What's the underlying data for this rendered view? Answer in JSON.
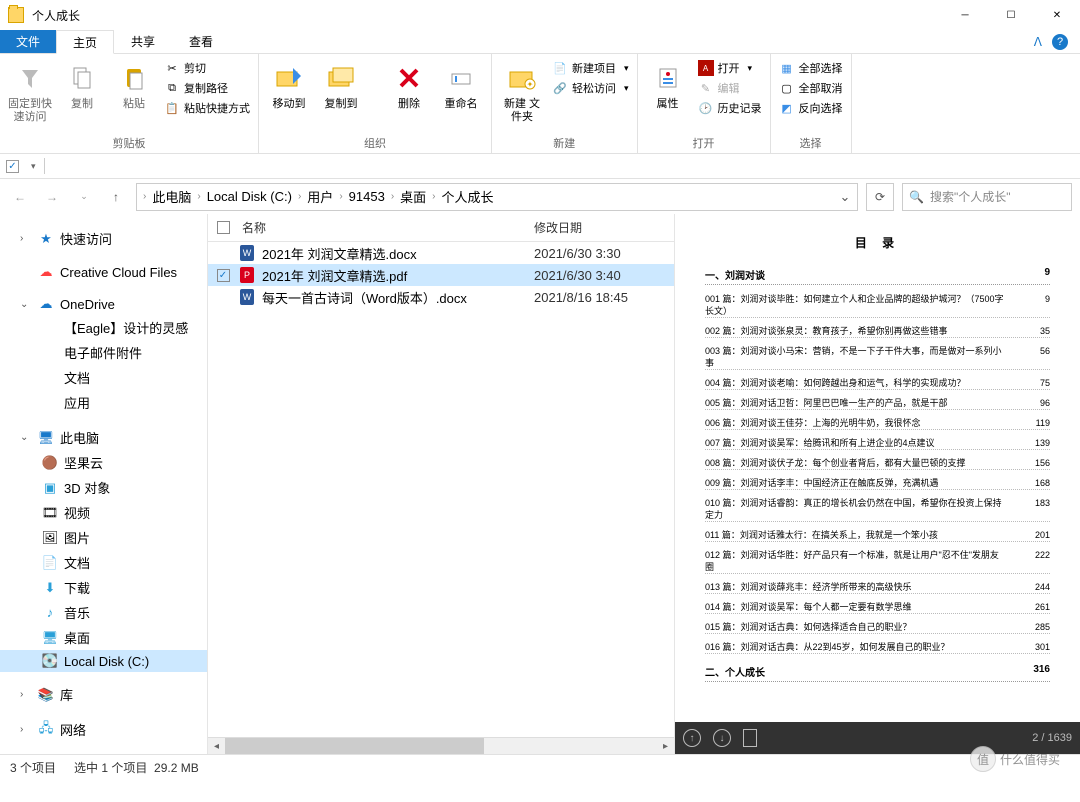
{
  "window": {
    "title": "个人成长"
  },
  "tabs": {
    "file": "文件",
    "home": "主页",
    "share": "共享",
    "view": "查看"
  },
  "ribbon": {
    "g1": {
      "pin": "固定到快\n速访问",
      "copy": "复制",
      "paste": "粘贴",
      "cut": "剪切",
      "copypath": "复制路径",
      "pasteshortcut": "粘贴快捷方式",
      "label": "剪贴板"
    },
    "g2": {
      "moveto": "移动到",
      "copyto": "复制到",
      "delete": "删除",
      "rename": "重命名",
      "label": "组织"
    },
    "g3": {
      "newfolder": "新建\n文件夹",
      "newitem": "新建项目",
      "easyaccess": "轻松访问",
      "label": "新建"
    },
    "g4": {
      "props": "属性",
      "open": "打开",
      "edit": "编辑",
      "history": "历史记录",
      "label": "打开"
    },
    "g5": {
      "selectall": "全部选择",
      "selectnone": "全部取消",
      "invert": "反向选择",
      "label": "选择"
    }
  },
  "breadcrumb": [
    "此电脑",
    "Local Disk (C:)",
    "用户",
    "91453",
    "桌面",
    "个人成长"
  ],
  "search": {
    "placeholder": "搜索\"个人成长\""
  },
  "columns": {
    "name": "名称",
    "date": "修改日期"
  },
  "files": [
    {
      "name": "2021年 刘润文章精选.docx",
      "date": "2021/6/30 3:30",
      "type": "docx",
      "sel": false
    },
    {
      "name": "2021年 刘润文章精选.pdf",
      "date": "2021/6/30 3:40",
      "type": "pdf",
      "sel": true
    },
    {
      "name": "每天一首古诗词（Word版本）.docx",
      "date": "2021/8/16 18:45",
      "type": "docx",
      "sel": false
    }
  ],
  "nav": {
    "quick": "快速访问",
    "ccf": "Creative Cloud Files",
    "onedrive": "OneDrive",
    "od": {
      "eagle": "【Eagle】设计的灵感",
      "email": "电子邮件附件",
      "docs": "文档",
      "apps": "应用"
    },
    "thispc": "此电脑",
    "pc": {
      "jgy": "坚果云",
      "obj3d": "3D 对象",
      "video": "视频",
      "pic": "图片",
      "doc": "文档",
      "dl": "下载",
      "music": "音乐",
      "desktop": "桌面",
      "cdisk": "Local Disk (C:)"
    },
    "lib": "库",
    "net": "网络"
  },
  "preview": {
    "toc_title": "目 录",
    "sec1": {
      "t": "一、刘润对谈",
      "p": "9"
    },
    "rows": [
      {
        "t": "001 篇：刘润对谈毕胜：如何建立个人和企业品牌的超级护城河？（7500字长文）",
        "p": "9"
      },
      {
        "t": "002 篇：刘润对谈张泉灵：教育孩子，希望你别再做这些错事",
        "p": "35"
      },
      {
        "t": "003 篇：刘润对谈小马宋：营销，不是一下子干件大事，而是做对一系列小事",
        "p": "56"
      },
      {
        "t": "004 篇：刘润对谈老喻：如何跨越出身和运气，科学的实现成功？",
        "p": "75"
      },
      {
        "t": "005 篇：刘润对话卫哲：阿里巴巴唯一生产的产品，就是干部",
        "p": "96"
      },
      {
        "t": "006 篇：刘润对谈王佳芬：上海的光明牛奶，我很怀念",
        "p": "119"
      },
      {
        "t": "007 篇：刘润对谈吴军：给腾讯和所有上进企业的4点建议",
        "p": "139"
      },
      {
        "t": "008 篇：刘润对谈伏子龙：每个创业者背后，都有大量巴顿的支撑",
        "p": "156"
      },
      {
        "t": "009 篇：刘润对话李丰：中国经济正在触底反弹，充满机遇",
        "p": "168"
      },
      {
        "t": "010 篇：刘润对话睿韵：真正的增长机会仍然在中国，希望你在投资上保持定力",
        "p": "183"
      },
      {
        "t": "011 篇：刘润对话雅太行：在搞关系上，我就是一个笨小孩",
        "p": "201"
      },
      {
        "t": "012 篇：刘润对话华胜：好产品只有一个标准，就是让用户\"忍不住\"发朋友圈",
        "p": "222"
      },
      {
        "t": "013 篇：刘润对谈薛兆丰：经济学所带来的高级快乐",
        "p": "244"
      },
      {
        "t": "014 篇：刘润对谈吴军：每个人都一定要有数学思维",
        "p": "261"
      },
      {
        "t": "015 篇：刘润对话古典：如何选择适合自己的职业？",
        "p": "285"
      },
      {
        "t": "016 篇：刘润对话古典：从22到45岁，如何发展自己的职业？",
        "p": "301"
      }
    ],
    "sec2": {
      "t": "二、个人成长",
      "p": "316"
    },
    "pager": "2 / 1639"
  },
  "status": {
    "count": "3 个项目",
    "sel": "选中 1 个项目",
    "size": "29.2 MB"
  },
  "watermark": "什么值得买"
}
